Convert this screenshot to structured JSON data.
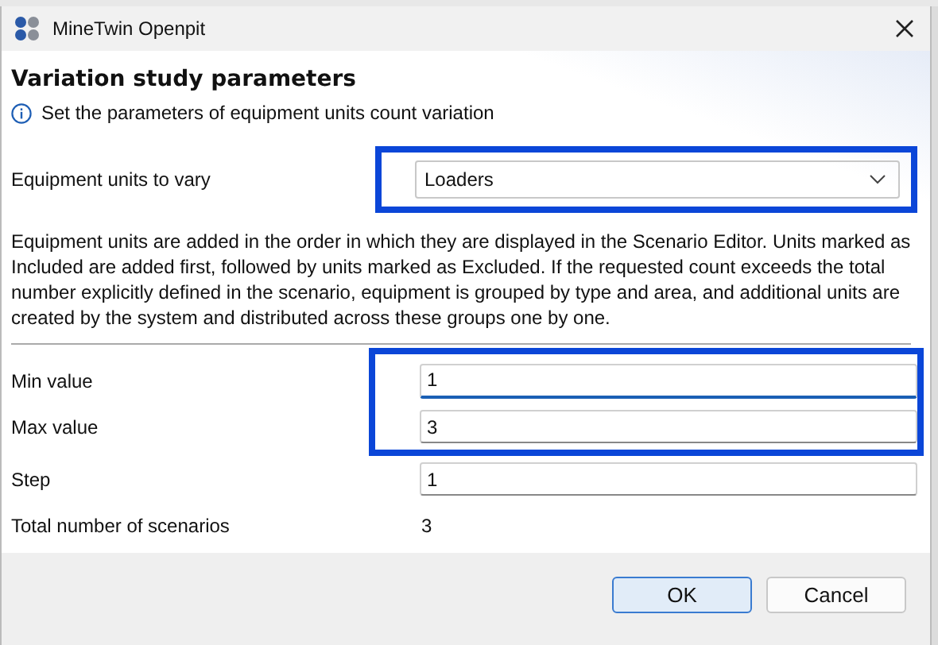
{
  "window": {
    "title": "MineTwin Openpit"
  },
  "header": {
    "title": "Variation study parameters",
    "info": "Set the parameters of equipment units count variation"
  },
  "equipment": {
    "label": "Equipment units to vary",
    "value": "Loaders",
    "highlighted": true
  },
  "description": "Equipment units are added in the order in which they are displayed in the Scenario Editor. Units marked as Included are added first, followed by units marked as Excluded. If the requested count exceeds the total number explicitly defined in the scenario, equipment is grouped by type and area, and additional units are created by the system and distributed across these groups one by one.",
  "parameter_groups": [
    {
      "highlighted": true,
      "items": [
        {
          "kind": "field",
          "label": "Min value",
          "value": "1",
          "focused": true
        },
        {
          "kind": "field",
          "label": "Max value",
          "value": "3",
          "focused": false
        }
      ]
    },
    {
      "items": [
        {
          "kind": "field",
          "label": "Step",
          "value": "1",
          "focused": false
        },
        {
          "kind": "readout",
          "label": "Total number of scenarios",
          "value": "3"
        }
      ]
    }
  ],
  "buttons": [
    {
      "label": "OK",
      "default": true
    },
    {
      "label": "Cancel",
      "default": false
    }
  ]
}
